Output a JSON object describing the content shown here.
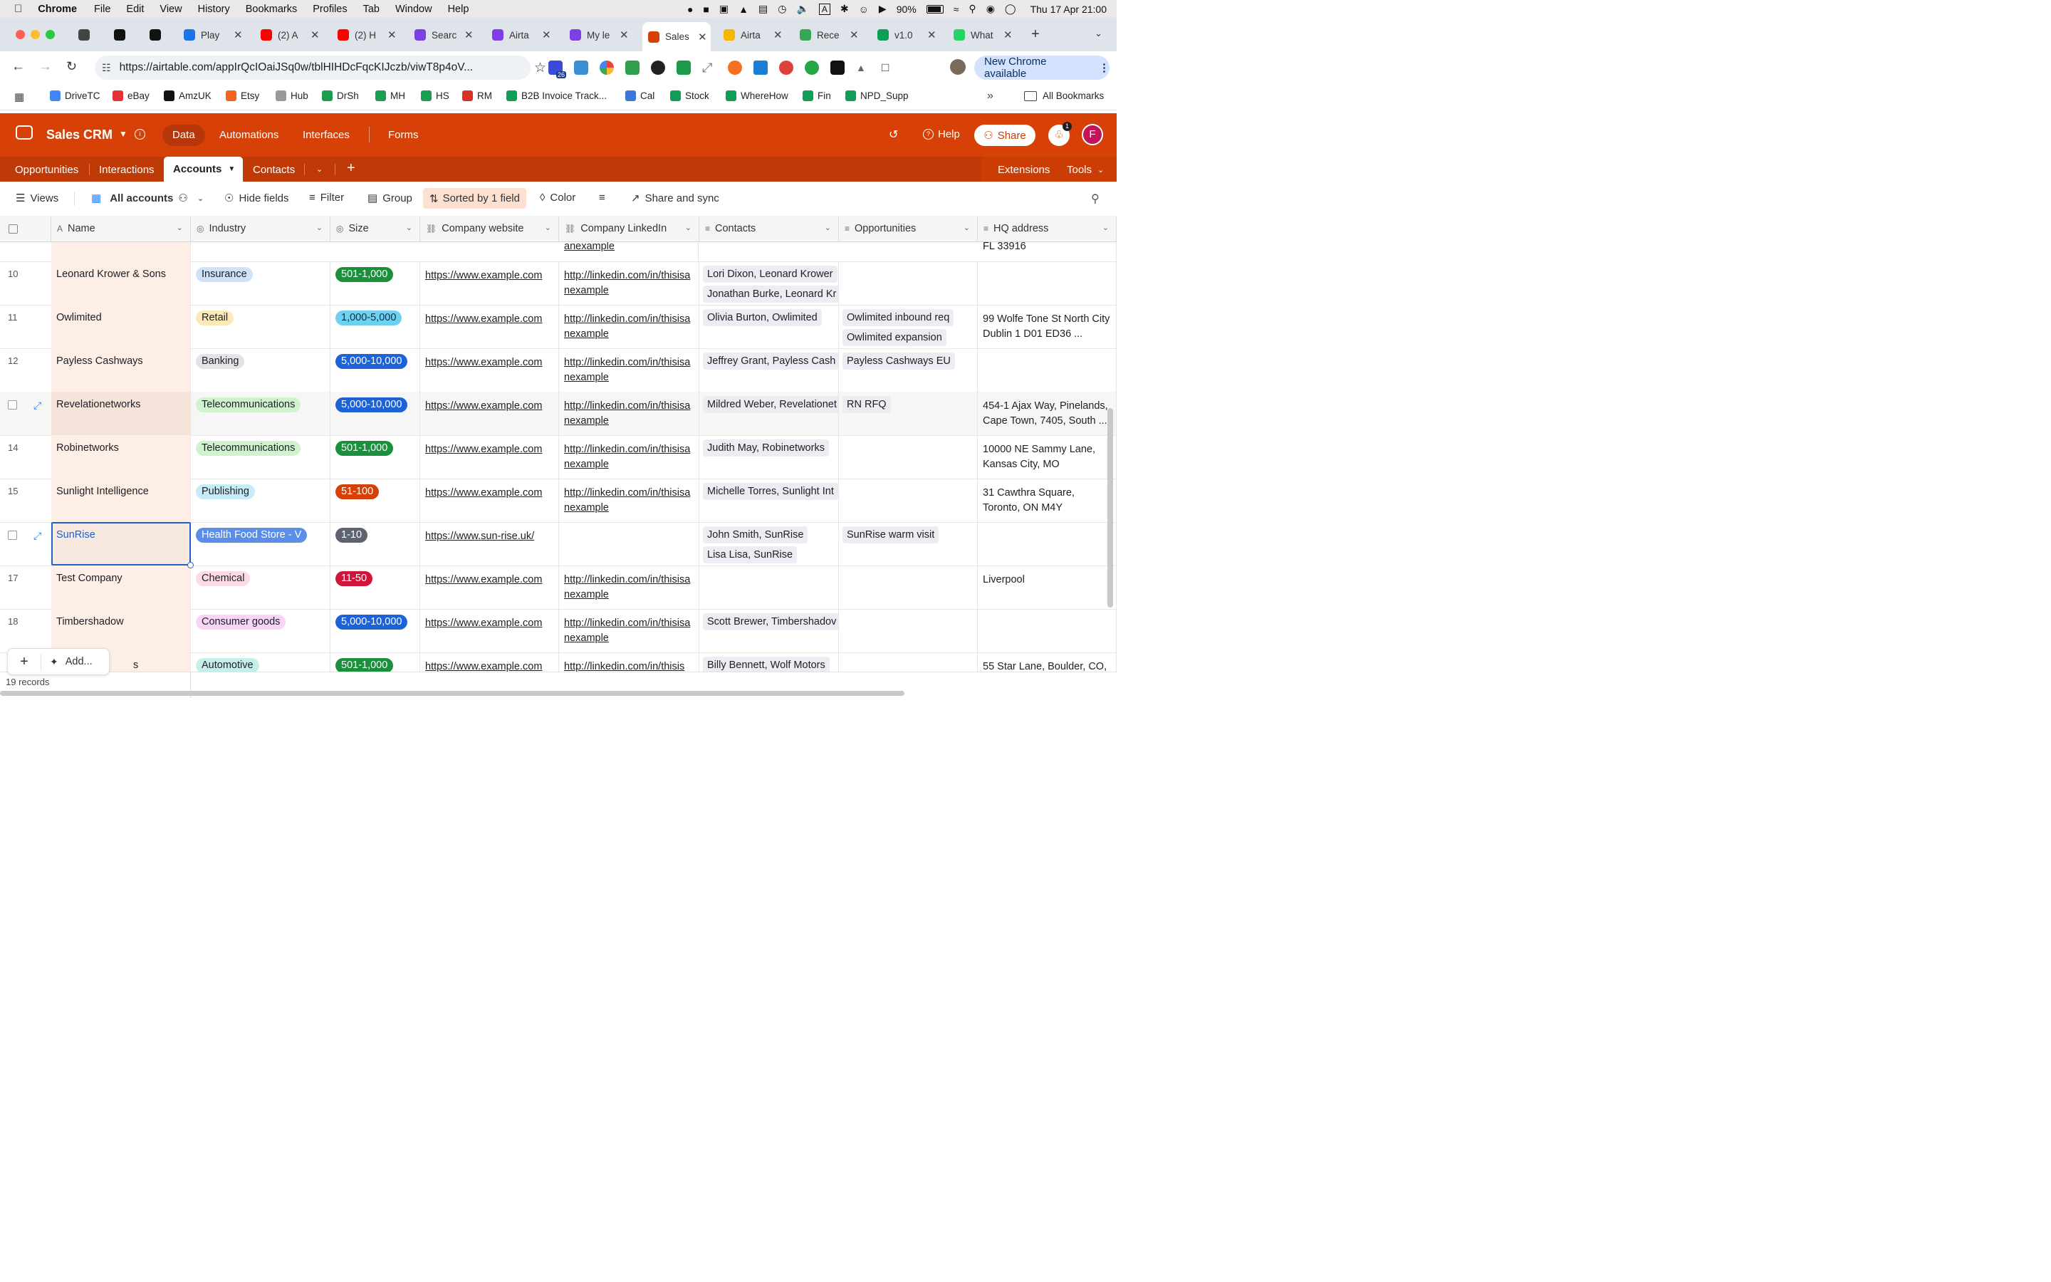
{
  "menubar": {
    "app": "Chrome",
    "items": [
      "File",
      "Edit",
      "View",
      "History",
      "Bookmarks",
      "Profiles",
      "Tab",
      "Window",
      "Help"
    ],
    "battery": "90%",
    "datetime": "Thu 17 Apr  21:00"
  },
  "tabs": [
    {
      "label": "",
      "color": "#444"
    },
    {
      "label": "",
      "color": "#111"
    },
    {
      "label": "",
      "color": "#111"
    },
    {
      "label": "Play",
      "color": "#1a73e8"
    },
    {
      "label": "(2) A",
      "color": "#ff0000"
    },
    {
      "label": "(2) H",
      "color": "#ff0000"
    },
    {
      "label": "Searc",
      "color": "#7b3fe4"
    },
    {
      "label": "Airta",
      "color": "#7b3fe4"
    },
    {
      "label": "My le",
      "color": "#7b3fe4"
    },
    {
      "label": "Sales",
      "color": "#d74108"
    },
    {
      "label": "Airta",
      "color": "#f7b500"
    },
    {
      "label": "Rece",
      "color": "#34a853"
    },
    {
      "label": "v1.0",
      "color": "#0f9d58"
    },
    {
      "label": "What",
      "color": "#25d366"
    }
  ],
  "url": "https://airtable.com/appIrQcIOaiJSq0w/tblHIHDcFqcKIJczb/viwT8p4oV...",
  "new_chrome": "New Chrome available",
  "extension_badge": "26",
  "bookmarks": [
    "DriveTC",
    "eBay",
    "AmzUK",
    "Etsy",
    "Hub",
    "DrSh",
    "MH",
    "HS",
    "RM",
    "B2B Invoice Track...",
    "Cal",
    "Stock",
    "WhereHow",
    "Fin",
    "NPD_Supp"
  ],
  "all_bookmarks": "All Bookmarks",
  "base": {
    "name": "Sales CRM",
    "nav": [
      "Data",
      "Automations",
      "Interfaces",
      "Forms"
    ],
    "help": "Help",
    "share": "Share",
    "notif_count": "1",
    "avatar": "F"
  },
  "table_tabs": [
    "Opportunities",
    "Interactions",
    "Accounts",
    "Contacts"
  ],
  "extensions": "Extensions",
  "tools": "Tools",
  "viewbar": {
    "views": "Views",
    "view_name": "All accounts",
    "hide_fields": "Hide fields",
    "filter": "Filter",
    "group": "Group",
    "sorted": "Sorted by 1 field",
    "color": "Color",
    "share_sync": "Share and sync"
  },
  "columns": [
    "Name",
    "Industry",
    "Size",
    "Company website",
    "Company LinkedIn",
    "Contacts",
    "Opportunities",
    "HQ address"
  ],
  "partial_row": {
    "linkedin_tail": "anexample",
    "address_tail": "FL 33916"
  },
  "rows": [
    {
      "num": "10",
      "name": "Leonard Krower & Sons",
      "industry": "Insurance",
      "industry_bg": "#cfe3f8",
      "size": "501-1,000",
      "size_bg": "#1a8f3c",
      "website": "https://www.example.com",
      "linkedin": "http://linkedin.com/in/thisisanexample",
      "contacts": [
        "Lori Dixon, Leonard Krower",
        "Jonathan Burke, Leonard Kr"
      ],
      "opps": [],
      "addr": ""
    },
    {
      "num": "11",
      "name": "Owlimited",
      "industry": "Retail",
      "industry_bg": "#fde9b8",
      "size": "1,000-5,000",
      "size_bg": "#6fd1f0",
      "website": "https://www.example.com",
      "linkedin": "http://linkedin.com/in/thisisanexample",
      "contacts": [
        "Olivia Burton, Owlimited"
      ],
      "opps": [
        "Owlimited inbound req",
        "Owlimited expansion"
      ],
      "addr": "99 Wolfe Tone St North City Dublin 1 D01 ED36 ..."
    },
    {
      "num": "12",
      "name": "Payless Cashways",
      "industry": "Banking",
      "industry_bg": "#e4e4e8",
      "size": "5,000-10,000",
      "size_bg": "#1d62d6",
      "website": "https://www.example.com",
      "linkedin": "http://linkedin.com/in/thisisanexample",
      "contacts": [
        "Jeffrey Grant, Payless Cash"
      ],
      "opps": [
        "Payless Cashways EU"
      ],
      "addr": ""
    },
    {
      "num": "",
      "name": "Revelationetworks",
      "industry": "Telecommunications",
      "industry_bg": "#d1f2cf",
      "size": "5,000-10,000",
      "size_bg": "#1d62d6",
      "website": "https://www.example.com",
      "linkedin": "http://linkedin.com/in/thisisanexample",
      "contacts": [
        "Mildred Weber, Revelationet"
      ],
      "opps": [
        "RN RFQ"
      ],
      "addr": "454-1 Ajax Way, Pinelands, Cape Town, 7405, South ..."
    },
    {
      "num": "14",
      "name": "Robinetworks",
      "industry": "Telecommunications",
      "industry_bg": "#d1f2cf",
      "size": "501-1,000",
      "size_bg": "#1a8f3c",
      "website": "https://www.example.com",
      "linkedin": "http://linkedin.com/in/thisisanexample",
      "contacts": [
        "Judith May, Robinetworks"
      ],
      "opps": [],
      "addr": "10000 NE Sammy Lane, Kansas City, MO"
    },
    {
      "num": "15",
      "name": "Sunlight Intelligence",
      "industry": "Publishing",
      "industry_bg": "#c6ecf9",
      "size": "51-100",
      "size_bg": "#d74108",
      "website": "https://www.example.com",
      "linkedin": "http://linkedin.com/in/thisisanexample",
      "contacts": [
        "Michelle Torres, Sunlight Int"
      ],
      "opps": [],
      "addr": "31 Cawthra Square, Toronto, ON M4Y"
    },
    {
      "num": "",
      "name": "SunRise",
      "industry": "Health Food Store - V",
      "industry_bg": "#5a8ee8",
      "size": "1-10",
      "size_bg": "#5d6470",
      "website": "https://www.sun-rise.uk/",
      "linkedin": "",
      "contacts": [
        "John Smith, SunRise",
        "Lisa Lisa, SunRise"
      ],
      "opps": [
        "SunRise warm visit"
      ],
      "addr": ""
    },
    {
      "num": "17",
      "name": "Test Company",
      "industry": "Chemical",
      "industry_bg": "#fcdbe5",
      "size": "11-50",
      "size_bg": "#d0143a",
      "website": "https://www.example.com",
      "linkedin": "http://linkedin.com/in/thisisanexample",
      "contacts": [],
      "opps": [],
      "addr": "Liverpool"
    },
    {
      "num": "18",
      "name": "Timbershadow",
      "industry": "Consumer goods",
      "industry_bg": "#f9d4f5",
      "size": "5,000-10,000",
      "size_bg": "#1d62d6",
      "website": "https://www.example.com",
      "linkedin": "http://linkedin.com/in/thisisanexample",
      "contacts": [
        "Scott Brewer, Timbershadov"
      ],
      "opps": [],
      "addr": ""
    },
    {
      "num": "",
      "name": "s",
      "industry": "Automotive",
      "industry_bg": "#c7efe9",
      "size": "501-1,000",
      "size_bg": "#1a8f3c",
      "website": "https://www.example.com",
      "linkedin": "http://linkedin.com/in/thisis",
      "contacts": [
        "Billy Bennett, Wolf Motors"
      ],
      "opps": [],
      "addr": "55 Star Lane, Boulder, CO,"
    }
  ],
  "footer": {
    "add": "Add...",
    "records": "19 records"
  }
}
